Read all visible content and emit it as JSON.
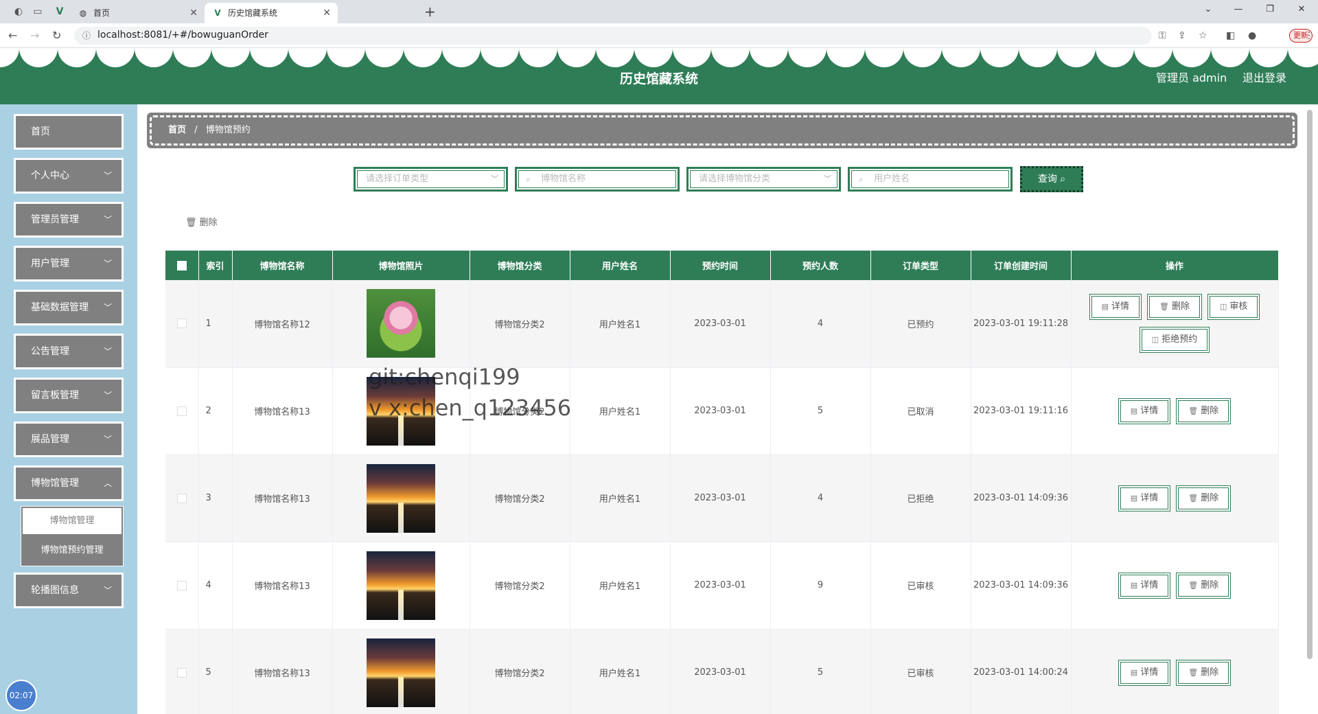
{
  "browser": {
    "tabs": [
      {
        "title": "首页",
        "active": false
      },
      {
        "title": "历史馆藏系统",
        "active": true
      }
    ],
    "url": "localhost:8081/+#/bowuguanOrder",
    "update_label": "更新"
  },
  "header": {
    "title": "历史馆藏系统",
    "user": "管理员 admin",
    "logout": "退出登录",
    "color": "#2e7d57"
  },
  "sidebar": {
    "items": [
      {
        "label": "首页"
      },
      {
        "label": "个人中心"
      },
      {
        "label": "管理员管理"
      },
      {
        "label": "用户管理"
      },
      {
        "label": "基础数据管理"
      },
      {
        "label": "公告管理"
      },
      {
        "label": "留言板管理"
      },
      {
        "label": "展品管理"
      },
      {
        "label": "博物馆管理"
      },
      {
        "label": "轮播图信息"
      }
    ],
    "submenu": [
      "博物馆管理",
      "博物馆预约管理"
    ],
    "clock": "02:07"
  },
  "breadcrumb": {
    "home": "首页",
    "sep": "/",
    "current": "博物馆预约"
  },
  "search": {
    "order_type_placeholder": "请选择订单类型",
    "museum_name_placeholder": "博物馆名称",
    "museum_category_placeholder": "请选择博物馆分类",
    "user_name_placeholder": "用户姓名",
    "query_label": "查询"
  },
  "bulk_delete": "删除",
  "table": {
    "headers": [
      "索引",
      "博物馆名称",
      "博物馆照片",
      "博物馆分类",
      "用户姓名",
      "预约时间",
      "预约人数",
      "订单类型",
      "订单创建时间",
      "操作"
    ],
    "rows": [
      {
        "index": "1",
        "name": "博物馆名称12",
        "image": "lotus",
        "category": "博物馆分类2",
        "user": "用户姓名1",
        "date": "2023-03-01",
        "count": "4",
        "type": "已预约",
        "created": "2023-03-01 19:11:28"
      },
      {
        "index": "2",
        "name": "博物馆名称13",
        "image": "sunset-road",
        "category": "博物馆分类2",
        "user": "用户姓名1",
        "date": "2023-03-01",
        "count": "5",
        "type": "已取消",
        "created": "2023-03-01 19:11:16"
      },
      {
        "index": "3",
        "name": "博物馆名称13",
        "image": "sunset-road",
        "category": "博物馆分类2",
        "user": "用户姓名1",
        "date": "2023-03-01",
        "count": "4",
        "type": "已拒绝",
        "created": "2023-03-01 14:09:36"
      },
      {
        "index": "4",
        "name": "博物馆名称13",
        "image": "sunset-road",
        "category": "博物馆分类2",
        "user": "用户姓名1",
        "date": "2023-03-01",
        "count": "9",
        "type": "已审核",
        "created": "2023-03-01 14:09:36"
      },
      {
        "index": "5",
        "name": "博物馆名称13",
        "image": "sunset-road",
        "category": "博物馆分类2",
        "user": "用户姓名1",
        "date": "2023-03-01",
        "count": "5",
        "type": "已审核",
        "created": "2023-03-01 14:00:24"
      }
    ],
    "actions": {
      "detail": "详情",
      "delete": "删除",
      "audit": "审核",
      "reject": "拒绝预约"
    }
  },
  "watermark": [
    "git:chenqi199",
    "v x:chen_q123456"
  ]
}
